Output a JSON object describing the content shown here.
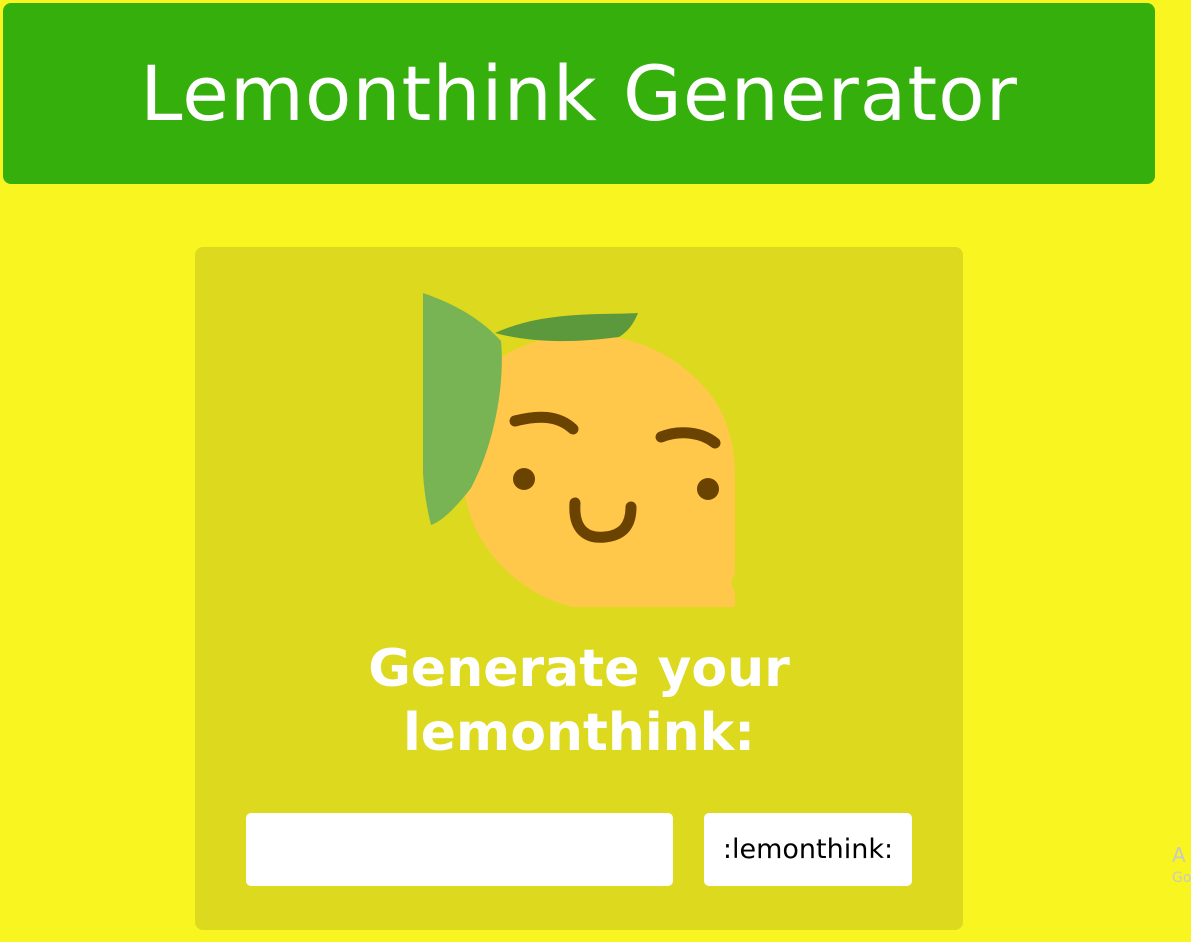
{
  "header": {
    "title": "Lemonthink Generator"
  },
  "card": {
    "mascot_icon": "lemon-think-icon",
    "prompt_line1": "Generate your",
    "prompt_line2": "lemonthink:",
    "input": {
      "value": "",
      "placeholder": ""
    },
    "button_label": ":lemonthink:"
  },
  "side_ad": {
    "line1": "A",
    "line2": "Go"
  },
  "colors": {
    "background": "#f8f520",
    "header": "#35af0c",
    "card": "#dcd91f",
    "lemon": "#ffc84a",
    "leaf_light": "#78b454",
    "leaf_dark": "#5c983c",
    "face": "#6b4300"
  }
}
